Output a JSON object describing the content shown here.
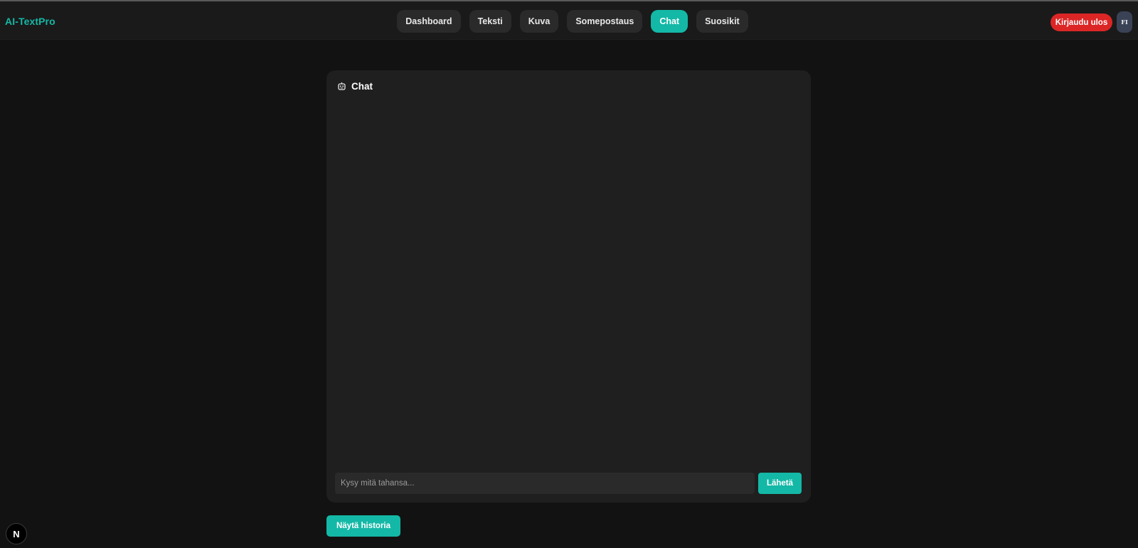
{
  "app": {
    "logo": "AI-TextPro"
  },
  "nav": {
    "items": [
      {
        "label": "Dashboard"
      },
      {
        "label": "Teksti"
      },
      {
        "label": "Kuva"
      },
      {
        "label": "Somepostaus"
      },
      {
        "label": "Chat",
        "active": true
      },
      {
        "label": "Suosikit"
      }
    ]
  },
  "header": {
    "logout_label": "Kirjaudu ulos",
    "language": "FI"
  },
  "chat": {
    "icon": "robot-icon",
    "title": "Chat",
    "input_placeholder": "Kysy mitä tahansa...",
    "input_value": "",
    "send_label": "Lähetä"
  },
  "history_button_label": "Näytä historia",
  "devtools_badge": "N",
  "colors": {
    "accent": "#14b8a6",
    "danger": "#dc2626",
    "background": "#121212",
    "card": "#1f1f1f"
  }
}
